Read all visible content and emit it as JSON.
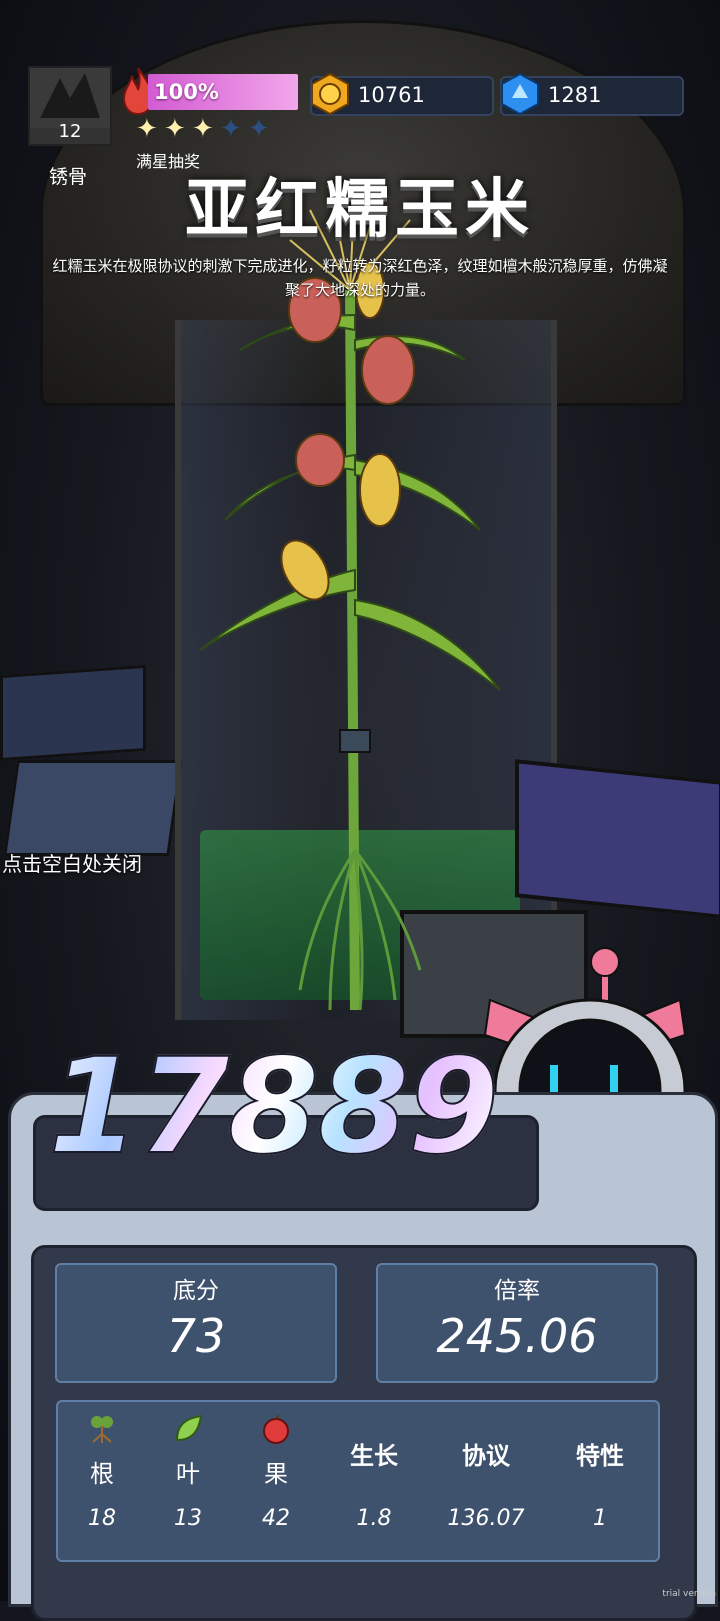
{
  "player": {
    "level": "12",
    "name": "锈骨"
  },
  "energy": {
    "percent_text": "100%",
    "value": 1.0
  },
  "stars": {
    "filled": 3,
    "total": 5,
    "label": "满星抽奖"
  },
  "currencies": [
    {
      "icon": "gold-coin-icon",
      "value": "10761"
    },
    {
      "icon": "blue-gem-icon",
      "value": "1281"
    }
  ],
  "plant": {
    "title": "亚红糯玉米",
    "description": "红糯玉米在极限协议的刺激下完成进化，籽粒转为深红色泽，纹理如檀木般沉稳厚重，仿佛凝聚了大地深处的力量。"
  },
  "close_hint": "点击空白处关闭",
  "score": "17889",
  "stats": {
    "base": {
      "label": "底分",
      "value": "73"
    },
    "multiplier": {
      "label": "倍率",
      "value": "245.06"
    }
  },
  "attributes": [
    {
      "name": "根",
      "value": "18",
      "icon": "root-icon"
    },
    {
      "name": "叶",
      "value": "13",
      "icon": "leaf-icon"
    },
    {
      "name": "果",
      "value": "42",
      "icon": "apple-icon"
    },
    {
      "name": "生长",
      "value": "1.8"
    },
    {
      "name": "协议",
      "value": "136.07"
    },
    {
      "name": "特性",
      "value": "1"
    }
  ],
  "watermark": "trial version",
  "colors": {
    "energy_bar": "#e07fe0",
    "panel": "#b9c4d4",
    "stat_box": "#3f526d"
  }
}
